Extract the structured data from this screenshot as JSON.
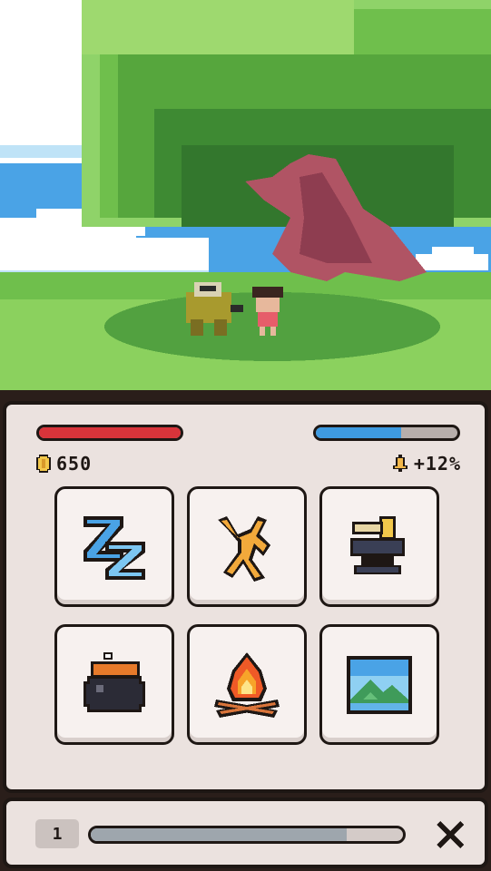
{
  "player": {
    "health_fraction": 1.0,
    "mana_fraction": 0.6
  },
  "stats": {
    "coins": "650",
    "bonus": "+12%"
  },
  "actions": [
    {
      "icon": "sleep-zz-icon"
    },
    {
      "icon": "train-figure-icon"
    },
    {
      "icon": "anvil-icon"
    },
    {
      "icon": "cooking-pot-icon"
    },
    {
      "icon": "campfire-icon"
    },
    {
      "icon": "landscape-picture-icon"
    }
  ],
  "footer": {
    "level": "1",
    "xp_fraction": 0.82
  },
  "colors": {
    "health": "#d8343a",
    "mana": "#3e9ae0",
    "panel_bg": "#ebe2df",
    "outline": "#1e1714"
  }
}
